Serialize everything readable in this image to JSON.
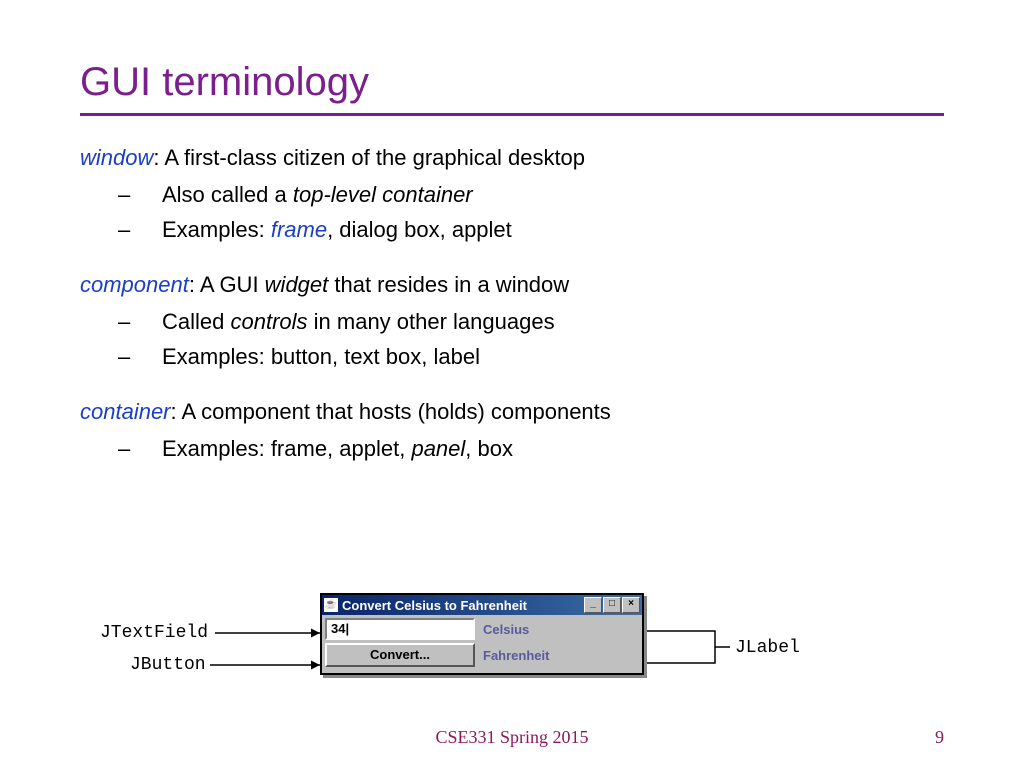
{
  "title": "GUI terminology",
  "defs": {
    "window": {
      "term": "window",
      "text": ": A first-class citizen of the graphical desktop",
      "subs": [
        {
          "pre": "Also called a ",
          "ital": "top-level container",
          "post": ""
        },
        {
          "pre": "Examples: ",
          "term": "frame",
          "post": ", dialog box, applet"
        }
      ]
    },
    "component": {
      "term": "component",
      "text_pre": ": A GUI ",
      "text_ital": "widget",
      "text_post": " that resides in a window",
      "subs": [
        {
          "pre": "Called ",
          "ital": "controls",
          "post": " in many other languages"
        },
        {
          "pre": "Examples: button, text box, label"
        }
      ]
    },
    "container": {
      "term": "container",
      "text": ": A component that hosts (holds) components",
      "subs": [
        {
          "pre": "Examples: frame, applet, ",
          "ital": "panel",
          "post": ", box"
        }
      ]
    }
  },
  "illust": {
    "window_title": "Convert Celsius to Fahrenheit",
    "textfield_value": "34",
    "button_label": "Convert...",
    "label1": "Celsius",
    "label2": "Fahrenheit",
    "annot_left_top": "JTextField",
    "annot_left_bottom": "JButton",
    "annot_right": "JLabel"
  },
  "footer": "CSE331 Spring 2015",
  "page": "9"
}
